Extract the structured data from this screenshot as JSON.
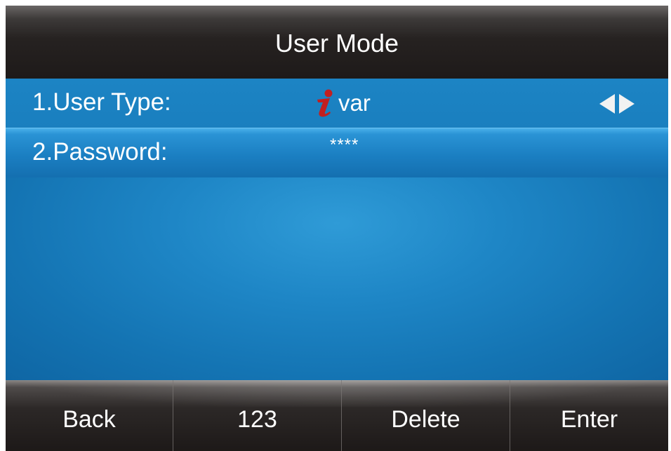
{
  "title": "User Mode",
  "menu": {
    "items": [
      {
        "label": "1.User Type:",
        "value": "var",
        "icon": "info-icon",
        "control": "left-right-arrows"
      },
      {
        "label": "2.Password:",
        "value": "****"
      }
    ],
    "selected_index": 1
  },
  "softkeys": [
    "Back",
    "123",
    "Delete",
    "Enter"
  ],
  "colors": {
    "title_bar": "#1e1a19",
    "background": "#1474b3",
    "highlight": "#2a93d5",
    "text": "#ffffff",
    "icon_red": "#c21f1f"
  }
}
